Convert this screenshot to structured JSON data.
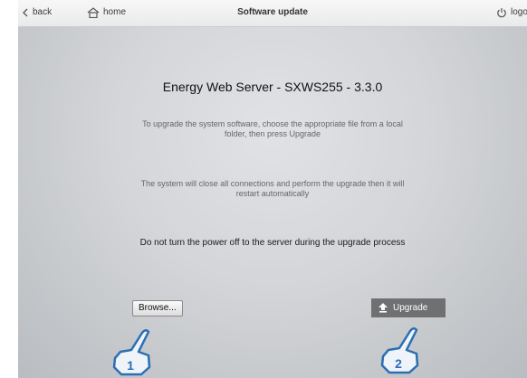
{
  "topbar": {
    "back_label": "back",
    "home_label": "home",
    "title": "Software update",
    "logout_label": "logo"
  },
  "main": {
    "product_title": "Energy Web Server - SXWS255 - 3.3.0",
    "instruction": "To upgrade the system software, choose the appropriate file from a local folder, then press Upgrade",
    "notice": "The system will close all connections and perform the upgrade then it will restart automatically",
    "warning": "Do not turn the power off to the server during the upgrade process"
  },
  "actions": {
    "browse_label": "Browse...",
    "upgrade_label": "Upgrade"
  },
  "callouts": [
    {
      "number": "1"
    },
    {
      "number": "2"
    }
  ],
  "icons": [
    "chevron-left-icon",
    "home-icon",
    "power-icon",
    "upload-icon",
    "hand-pointer-icon"
  ],
  "colors": {
    "topbar": "#eeeeee",
    "content": "#d3d5d8",
    "upgrade_button": "#6e7072",
    "callout_fill": "#eef4fa",
    "callout_stroke": "#2c6fb1"
  }
}
